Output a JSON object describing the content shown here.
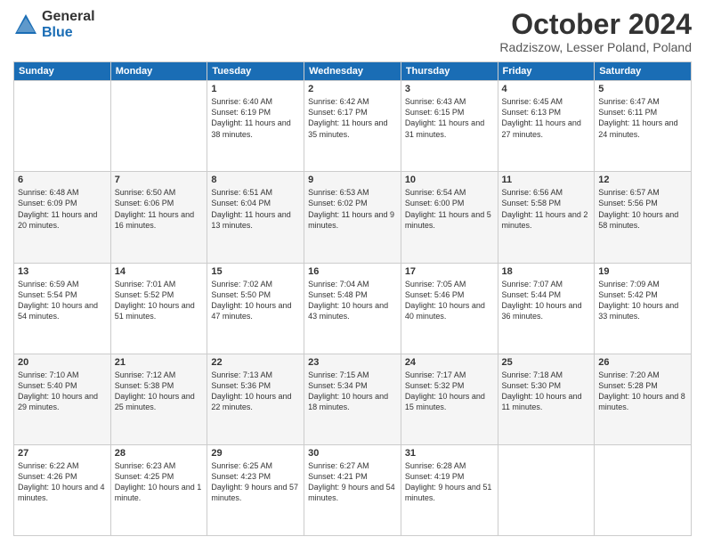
{
  "logo": {
    "general": "General",
    "blue": "Blue"
  },
  "header": {
    "month": "October 2024",
    "location": "Radziszow, Lesser Poland, Poland"
  },
  "weekdays": [
    "Sunday",
    "Monday",
    "Tuesday",
    "Wednesday",
    "Thursday",
    "Friday",
    "Saturday"
  ],
  "weeks": [
    [
      null,
      null,
      {
        "day": 1,
        "sunrise": "6:40 AM",
        "sunset": "6:19 PM",
        "daylight": "11 hours and 38 minutes."
      },
      {
        "day": 2,
        "sunrise": "6:42 AM",
        "sunset": "6:17 PM",
        "daylight": "11 hours and 35 minutes."
      },
      {
        "day": 3,
        "sunrise": "6:43 AM",
        "sunset": "6:15 PM",
        "daylight": "11 hours and 31 minutes."
      },
      {
        "day": 4,
        "sunrise": "6:45 AM",
        "sunset": "6:13 PM",
        "daylight": "11 hours and 27 minutes."
      },
      {
        "day": 5,
        "sunrise": "6:47 AM",
        "sunset": "6:11 PM",
        "daylight": "11 hours and 24 minutes."
      }
    ],
    [
      {
        "day": 6,
        "sunrise": "6:48 AM",
        "sunset": "6:09 PM",
        "daylight": "11 hours and 20 minutes."
      },
      {
        "day": 7,
        "sunrise": "6:50 AM",
        "sunset": "6:06 PM",
        "daylight": "11 hours and 16 minutes."
      },
      {
        "day": 8,
        "sunrise": "6:51 AM",
        "sunset": "6:04 PM",
        "daylight": "11 hours and 13 minutes."
      },
      {
        "day": 9,
        "sunrise": "6:53 AM",
        "sunset": "6:02 PM",
        "daylight": "11 hours and 9 minutes."
      },
      {
        "day": 10,
        "sunrise": "6:54 AM",
        "sunset": "6:00 PM",
        "daylight": "11 hours and 5 minutes."
      },
      {
        "day": 11,
        "sunrise": "6:56 AM",
        "sunset": "5:58 PM",
        "daylight": "11 hours and 2 minutes."
      },
      {
        "day": 12,
        "sunrise": "6:57 AM",
        "sunset": "5:56 PM",
        "daylight": "10 hours and 58 minutes."
      }
    ],
    [
      {
        "day": 13,
        "sunrise": "6:59 AM",
        "sunset": "5:54 PM",
        "daylight": "10 hours and 54 minutes."
      },
      {
        "day": 14,
        "sunrise": "7:01 AM",
        "sunset": "5:52 PM",
        "daylight": "10 hours and 51 minutes."
      },
      {
        "day": 15,
        "sunrise": "7:02 AM",
        "sunset": "5:50 PM",
        "daylight": "10 hours and 47 minutes."
      },
      {
        "day": 16,
        "sunrise": "7:04 AM",
        "sunset": "5:48 PM",
        "daylight": "10 hours and 43 minutes."
      },
      {
        "day": 17,
        "sunrise": "7:05 AM",
        "sunset": "5:46 PM",
        "daylight": "10 hours and 40 minutes."
      },
      {
        "day": 18,
        "sunrise": "7:07 AM",
        "sunset": "5:44 PM",
        "daylight": "10 hours and 36 minutes."
      },
      {
        "day": 19,
        "sunrise": "7:09 AM",
        "sunset": "5:42 PM",
        "daylight": "10 hours and 33 minutes."
      }
    ],
    [
      {
        "day": 20,
        "sunrise": "7:10 AM",
        "sunset": "5:40 PM",
        "daylight": "10 hours and 29 minutes."
      },
      {
        "day": 21,
        "sunrise": "7:12 AM",
        "sunset": "5:38 PM",
        "daylight": "10 hours and 25 minutes."
      },
      {
        "day": 22,
        "sunrise": "7:13 AM",
        "sunset": "5:36 PM",
        "daylight": "10 hours and 22 minutes."
      },
      {
        "day": 23,
        "sunrise": "7:15 AM",
        "sunset": "5:34 PM",
        "daylight": "10 hours and 18 minutes."
      },
      {
        "day": 24,
        "sunrise": "7:17 AM",
        "sunset": "5:32 PM",
        "daylight": "10 hours and 15 minutes."
      },
      {
        "day": 25,
        "sunrise": "7:18 AM",
        "sunset": "5:30 PM",
        "daylight": "10 hours and 11 minutes."
      },
      {
        "day": 26,
        "sunrise": "7:20 AM",
        "sunset": "5:28 PM",
        "daylight": "10 hours and 8 minutes."
      }
    ],
    [
      {
        "day": 27,
        "sunrise": "6:22 AM",
        "sunset": "4:26 PM",
        "daylight": "10 hours and 4 minutes."
      },
      {
        "day": 28,
        "sunrise": "6:23 AM",
        "sunset": "4:25 PM",
        "daylight": "10 hours and 1 minute."
      },
      {
        "day": 29,
        "sunrise": "6:25 AM",
        "sunset": "4:23 PM",
        "daylight": "9 hours and 57 minutes."
      },
      {
        "day": 30,
        "sunrise": "6:27 AM",
        "sunset": "4:21 PM",
        "daylight": "9 hours and 54 minutes."
      },
      {
        "day": 31,
        "sunrise": "6:28 AM",
        "sunset": "4:19 PM",
        "daylight": "9 hours and 51 minutes."
      },
      null,
      null
    ]
  ]
}
